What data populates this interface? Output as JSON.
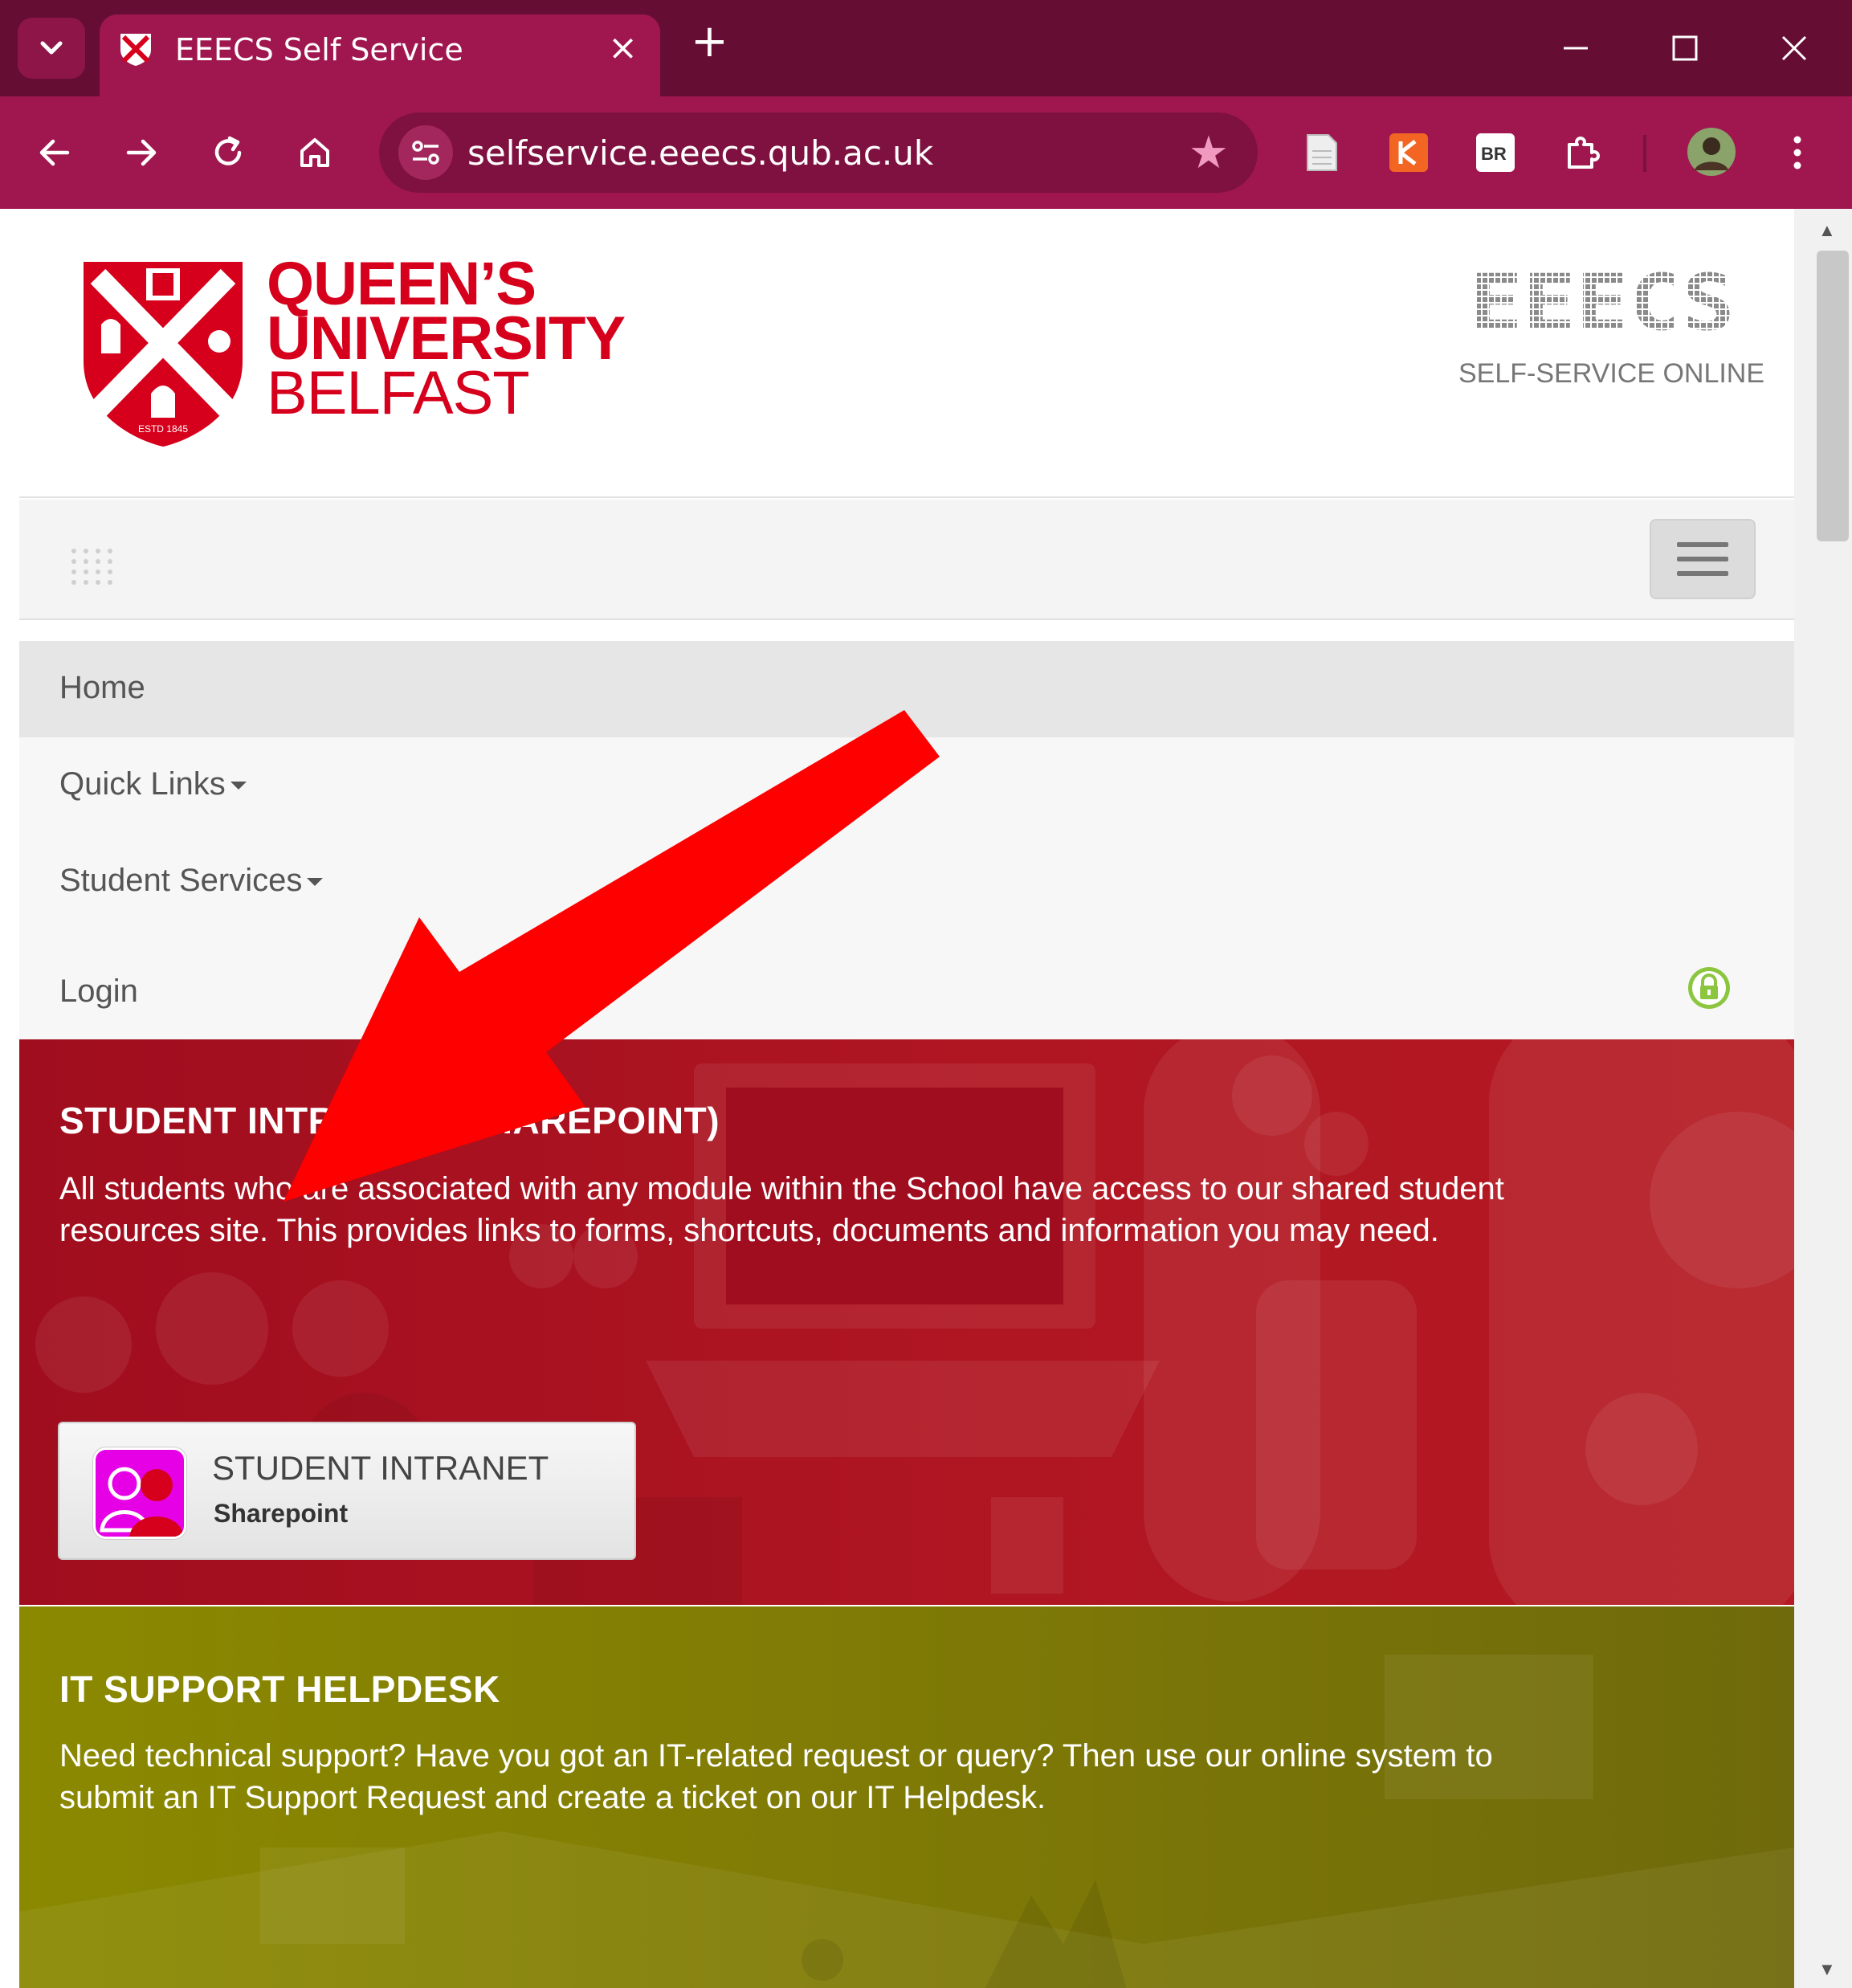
{
  "browser": {
    "tab_title": "EEECS Self Service",
    "tab_close": "×",
    "new_tab": "+",
    "url": "selfservice.eeecs.qub.ac.uk",
    "star": "★"
  },
  "header": {
    "university_name_line1": "QUEEN’S",
    "university_name_line2": "UNIVERSITY",
    "university_name_line3": "BELFAST",
    "crest_text": "ESTD 1845",
    "eeecs_logo_text": "EEECS",
    "tagline": "SELF-SERVICE ONLINE"
  },
  "menu": {
    "home": "Home",
    "quick_links": "Quick Links",
    "student_services": "Student Services",
    "login": "Login"
  },
  "sections": {
    "intranet": {
      "title": "STUDENT INTRANET (SHAREPOINT)",
      "body": "All students who are associated with any module within the School have access to our shared student resources site. This provides links to forms, shortcuts, documents and information you may need.",
      "tile_title": "STUDENT INTRANET",
      "tile_subtitle": "Sharepoint"
    },
    "helpdesk": {
      "title": "IT SUPPORT HELPDESK",
      "body": "Need technical support? Have you got an IT-related request or query? Then use our online system to submit an IT Support Request and create a ticket on our IT Helpdesk."
    }
  },
  "icons": {
    "browser": [
      "chevron-down-icon",
      "favicon-icon",
      "back-icon",
      "forward-icon",
      "reload-icon",
      "home-icon",
      "site-info-icon",
      "bookmark-star-icon",
      "document-extension-icon",
      "kaspersky-extension-icon",
      "br-extension-icon",
      "extensions-puzzle-icon",
      "profile-avatar-icon",
      "menu-kebab-icon"
    ],
    "page": [
      "qub-crest-icon",
      "grip-dots-icon",
      "hamburger-menu-icon",
      "lock-icon",
      "people-icon",
      "annotation-arrow-icon"
    ]
  },
  "colors": {
    "chrome_tabstrip": "#650d33",
    "chrome_toolbar": "#a01750",
    "qub_red": "#d6001c",
    "intranet_section": "#a00d1e",
    "helpdesk_section": "#8b8900",
    "lock_green": "#8cc63f",
    "annotation_arrow": "#ff0000"
  }
}
